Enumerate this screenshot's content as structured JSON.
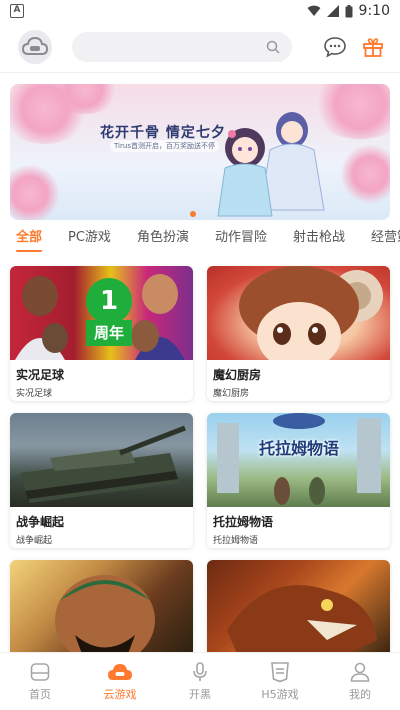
{
  "statusbar": {
    "time": "9:10"
  },
  "header": {
    "search_placeholder": ""
  },
  "banner": {
    "title": "花开千骨  情定七夕",
    "subtitle": "Tirus首测开启，百万奖励送不停",
    "page_count": 1,
    "active_page": 0
  },
  "tabs": [
    {
      "label": "全部",
      "active": true
    },
    {
      "label": "PC游戏",
      "active": false
    },
    {
      "label": "角色扮演",
      "active": false
    },
    {
      "label": "动作冒险",
      "active": false
    },
    {
      "label": "射击枪战",
      "active": false
    },
    {
      "label": "经营策略",
      "active": false
    }
  ],
  "games": [
    {
      "title": "实况足球",
      "subtitle": "实况足球",
      "badge_top": "1",
      "badge_bottom": "周年"
    },
    {
      "title": "魔幻厨房",
      "subtitle": "魔幻厨房"
    },
    {
      "title": "战争崛起",
      "subtitle": "战争崛起"
    },
    {
      "title": "托拉姆物语",
      "subtitle": "托拉姆物语",
      "art_text": "托拉姆物语"
    },
    {
      "title": "",
      "subtitle": ""
    },
    {
      "title": "",
      "subtitle": ""
    }
  ],
  "bottom_nav": [
    {
      "label": "首页",
      "icon": "home-icon",
      "active": false
    },
    {
      "label": "云游戏",
      "icon": "cloud-game-icon",
      "active": true
    },
    {
      "label": "开黑",
      "icon": "microphone-icon",
      "active": false
    },
    {
      "label": "H5游戏",
      "icon": "h5-badge-icon",
      "active": false
    },
    {
      "label": "我的",
      "icon": "profile-icon",
      "active": false
    }
  ],
  "colors": {
    "accent": "#ff7a2e",
    "inactive": "#9a9a9a"
  }
}
